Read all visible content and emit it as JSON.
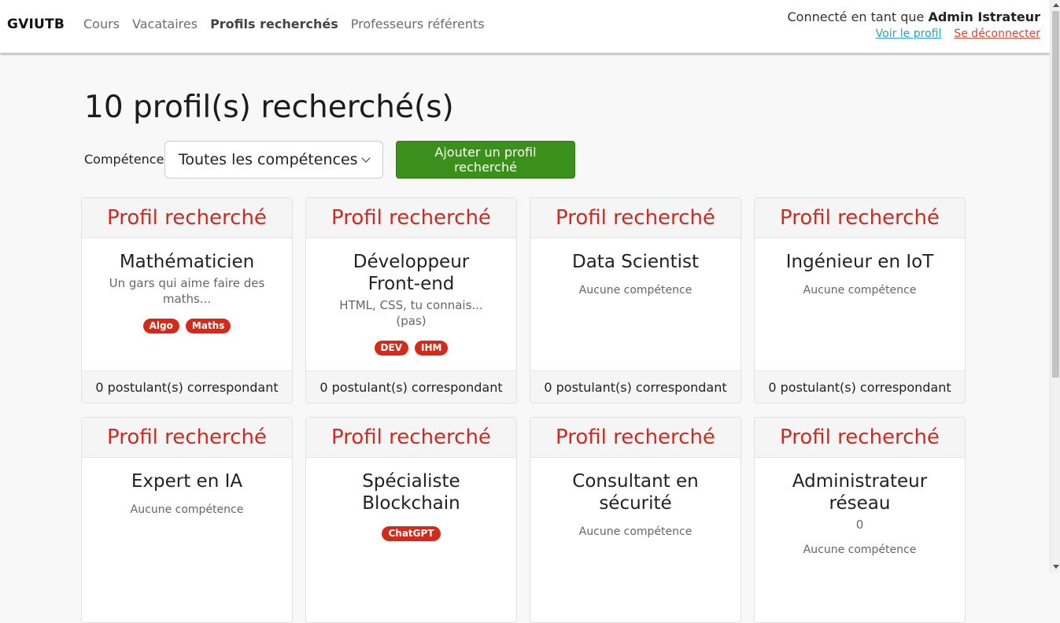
{
  "navbar": {
    "brand": "GVIUTB",
    "links": [
      {
        "label": "Cours",
        "active": false
      },
      {
        "label": "Vacataires",
        "active": false
      },
      {
        "label": "Profils recherchés",
        "active": true
      },
      {
        "label": "Professeurs référents",
        "active": false
      }
    ],
    "user": {
      "prefix": "Connecté en tant que ",
      "name": "Admin Istrateur",
      "profile_link": "Voir le profil",
      "logout_link": "Se déconnecter"
    }
  },
  "page": {
    "title": "10 profil(s) recherché(s)",
    "filter_label": "Compétence",
    "filter_value": "Toutes les compétences",
    "add_button": "Ajouter un profil recherché"
  },
  "cards": [
    {
      "header": "Profil recherché",
      "title": "Mathématicien",
      "description": "Un gars qui aime faire des maths...",
      "skills": [
        "Algo",
        "Maths"
      ],
      "no_skill": "",
      "footer": "0 postulant(s) correspondant"
    },
    {
      "header": "Profil recherché",
      "title": "Développeur Front-end",
      "description": "HTML, CSS, tu connais... (pas)",
      "skills": [
        "DEV",
        "IHM"
      ],
      "no_skill": "",
      "footer": "0 postulant(s) correspondant"
    },
    {
      "header": "Profil recherché",
      "title": "Data Scientist",
      "description": "",
      "skills": [],
      "no_skill": "Aucune compétence",
      "footer": "0 postulant(s) correspondant"
    },
    {
      "header": "Profil recherché",
      "title": "Ingénieur en IoT",
      "description": "",
      "skills": [],
      "no_skill": "Aucune compétence",
      "footer": "0 postulant(s) correspondant"
    },
    {
      "header": "Profil recherché",
      "title": "Expert en IA",
      "description": "",
      "skills": [],
      "no_skill": "Aucune compétence",
      "footer": ""
    },
    {
      "header": "Profil recherché",
      "title": "Spécialiste Blockchain",
      "description": "",
      "skills": [
        "ChatGPT"
      ],
      "no_skill": "",
      "footer": ""
    },
    {
      "header": "Profil recherché",
      "title": "Consultant en sécurité",
      "description": "",
      "skills": [],
      "no_skill": "Aucune compétence",
      "footer": ""
    },
    {
      "header": "Profil recherché",
      "title": "Administrateur réseau",
      "description": "0",
      "skills": [],
      "no_skill": "Aucune compétence",
      "footer": ""
    }
  ],
  "colors": {
    "accent_red": "#cf2a1f",
    "badge_red": "#d32a19",
    "button_green": "#3b8f1b",
    "link_blue": "#2a9fd0",
    "logout_red": "#d9462f"
  }
}
